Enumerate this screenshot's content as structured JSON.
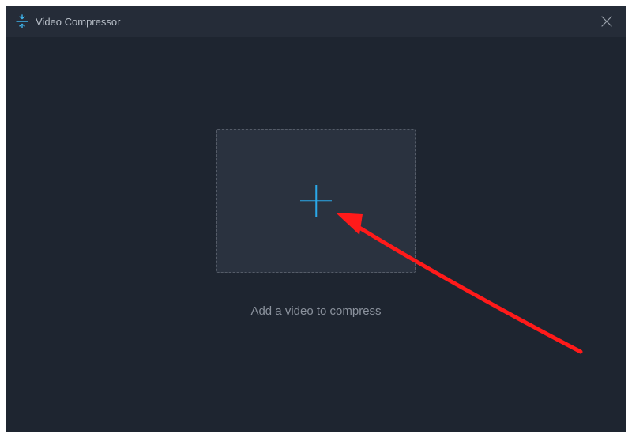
{
  "window": {
    "title": "Video Compressor"
  },
  "main": {
    "hint": "Add a video to compress"
  }
}
